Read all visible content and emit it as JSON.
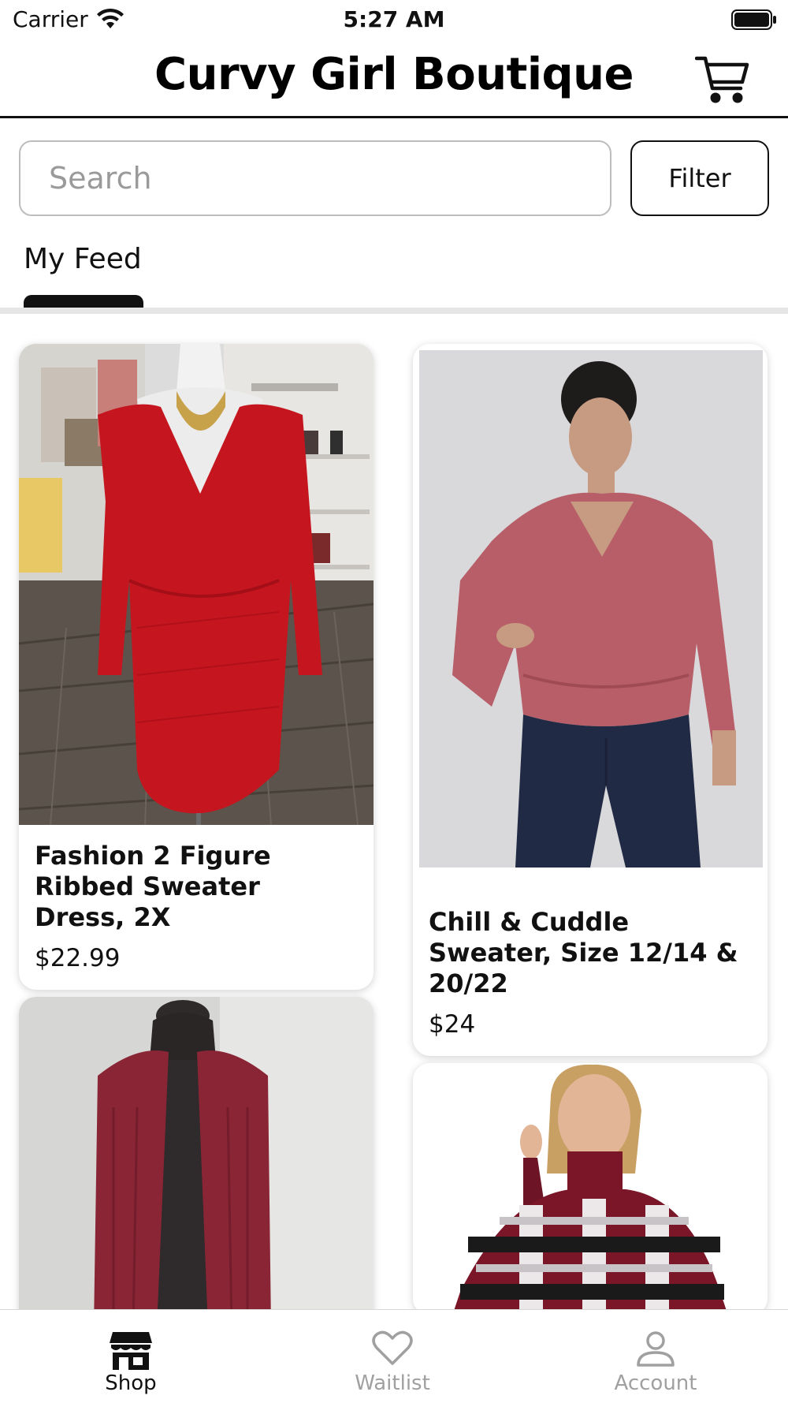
{
  "status_bar": {
    "carrier": "Carrier",
    "time": "5:27 AM",
    "wifi_icon": "wifi-icon",
    "battery_icon": "battery-icon"
  },
  "header": {
    "title": "Curvy Girl Boutique",
    "cart_icon": "cart-icon"
  },
  "search": {
    "placeholder": "Search",
    "value": ""
  },
  "filter": {
    "label": "Filter"
  },
  "tabs": [
    {
      "label": "My Feed",
      "active": true
    }
  ],
  "products": [
    {
      "name": "Fashion 2 Figure Ribbed Sweater Dress, 2X",
      "price": "$22.99",
      "image": "red ribbed wrap sweater dress on mannequin in boutique"
    },
    {
      "name": "Chill & Cuddle Sweater, Size 12/14 & 20/22",
      "price": "$24",
      "image": "woman wearing rose wrap sweater and dark jeans"
    },
    {
      "name": "",
      "price": "",
      "image": "burgundy open cardigan on black mannequin"
    },
    {
      "name": "",
      "price": "",
      "image": "woman in burgundy turtleneck plaid poncho"
    }
  ],
  "bottom_nav": [
    {
      "label": "Shop",
      "icon": "storefront-icon",
      "active": true
    },
    {
      "label": "Waitlist",
      "icon": "heart-icon",
      "active": false
    },
    {
      "label": "Account",
      "icon": "person-icon",
      "active": false
    }
  ],
  "colors": {
    "text": "#111111",
    "inactive": "#a0a0a0",
    "divider": "#e6e6e6",
    "border": "#bdbdbd"
  }
}
